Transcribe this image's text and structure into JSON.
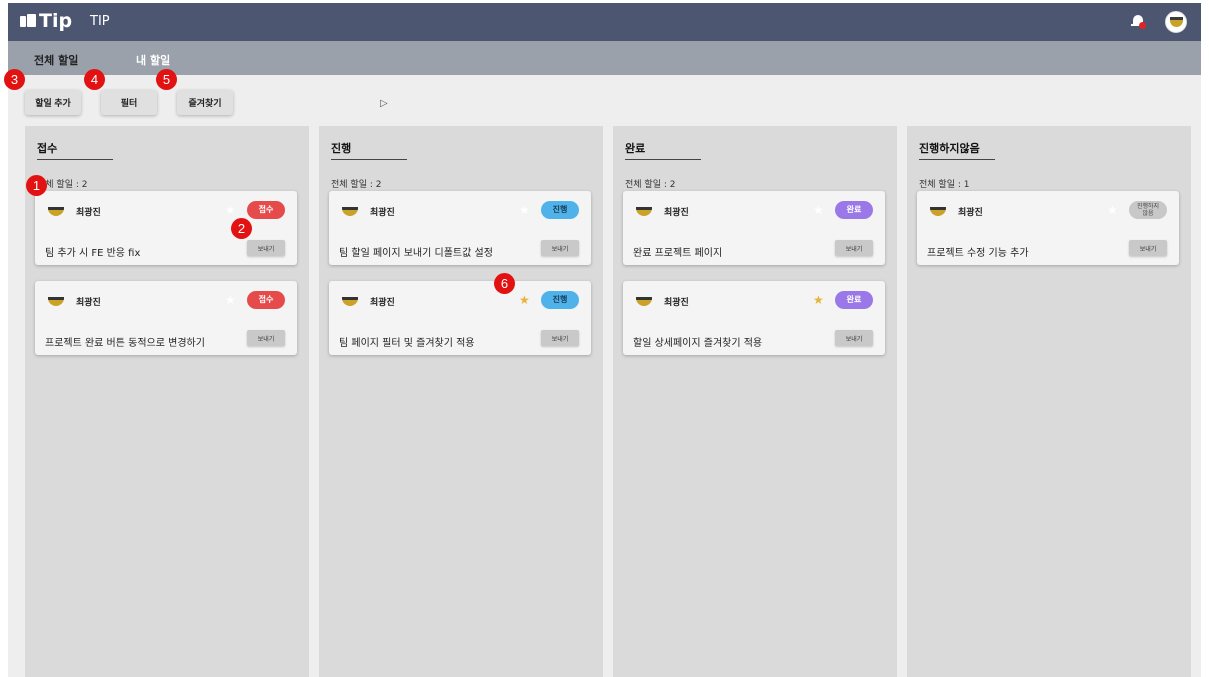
{
  "app": {
    "logo": "Tip",
    "title": "TIP",
    "logo_icon": "notebook-icon"
  },
  "header": {
    "notification_icon": "bell-icon",
    "notification_color": "#e02424"
  },
  "subnav": {
    "tabs": [
      {
        "label": "전체 할일"
      },
      {
        "label": "내 할일"
      }
    ]
  },
  "toolbar": {
    "add_label": "할일 추가",
    "filter_label": "필터",
    "favorites_label": "즐겨찾기"
  },
  "columns": [
    {
      "title": "접수",
      "count_label": "전체 할일 : 2",
      "cards": [
        {
          "user": "최광진",
          "status": "접수",
          "favorite": false,
          "task": "팀 추가 시 FE 반응 fix",
          "send": "보내기"
        },
        {
          "user": "최광진",
          "status": "접수",
          "favorite": false,
          "task": "프로젝트 완료 버튼 동적으로 변경하기",
          "send": "보내기"
        }
      ]
    },
    {
      "title": "진행",
      "count_label": "전체 할일 : 2",
      "cards": [
        {
          "user": "최광진",
          "status": "진행",
          "favorite": false,
          "task": "팀 할일 페이지 보내기 디폴트값 설정",
          "send": "보내기"
        },
        {
          "user": "최광진",
          "status": "진행",
          "favorite": true,
          "task": "팀 페이지 필터 및 즐겨찾기 적용",
          "send": "보내기"
        }
      ]
    },
    {
      "title": "완료",
      "count_label": "전체 할일 : 2",
      "cards": [
        {
          "user": "최광진",
          "status": "완료",
          "favorite": false,
          "task": "완료 프로젝트 페이지",
          "send": "보내기"
        },
        {
          "user": "최광진",
          "status": "완료",
          "favorite": true,
          "task": "할일 상세페이지 즐겨찾기 적용",
          "send": "보내기"
        }
      ]
    },
    {
      "title": "진행하지않음",
      "count_label": "전체 할일 : 1",
      "cards": [
        {
          "user": "최광진",
          "status": "진행하지\n않음",
          "favorite": false,
          "task": "프로젝트 수정 기능 추가",
          "send": "보내기"
        }
      ]
    }
  ],
  "markers": [
    "1",
    "2",
    "3",
    "4",
    "5",
    "6"
  ],
  "colors": {
    "topbar": "#4c5670",
    "subnav": "#9aa1ab",
    "received": "#e64b4b",
    "progress": "#4fb3ea",
    "done": "#9b78e8",
    "not_started": "#c8c8c8",
    "marker": "#e31212",
    "favorite": "#e8b33a"
  }
}
